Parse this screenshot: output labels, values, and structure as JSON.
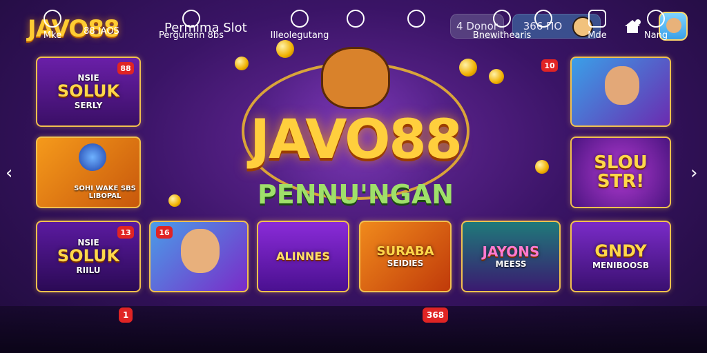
{
  "header": {
    "logo": "JAVO88",
    "title": "Permima Slot",
    "donor_button": "4 Donor",
    "balance": "366 ΠΟ"
  },
  "hero": {
    "title": "JAVO88",
    "subtitle": "PENNU'NGAN"
  },
  "tiles": {
    "t1": {
      "title": "SOLUK",
      "top": "NSIE",
      "sub": "SERLY",
      "badge": "88"
    },
    "t2": {
      "title": "",
      "sub": "SOHI WAKE SBS LIBOPAL"
    },
    "t3": {
      "badge": "10"
    },
    "t4": {
      "title": "SLOU STR!"
    },
    "t5": {
      "title": "SOLUK",
      "top": "NSIE",
      "sub": "RIILU",
      "badge": "13"
    },
    "t6": {
      "badge": "16"
    },
    "t7": {
      "title": "ALINNES"
    },
    "t8": {
      "title": "SURABA",
      "sub": "SEIDIES"
    },
    "t9": {
      "title": "JAYONS",
      "sub": "MEESS"
    },
    "t10": {
      "title": "GNDY",
      "sub": "MENIBOOSB"
    }
  },
  "bottom_nav": [
    {
      "label": "Mke",
      "icon": "compass-icon"
    },
    {
      "label": "88 IAOS",
      "icon": ""
    },
    {
      "label": "Pergurenn 8bs",
      "icon": "gauge-icon"
    },
    {
      "label": "Illeolegutang",
      "icon": "download-icon"
    },
    {
      "label": "",
      "icon": "clock-icon"
    },
    {
      "label": "",
      "icon": "gear-icon"
    },
    {
      "label": "Bnewithearis",
      "icon": "circle-icon"
    },
    {
      "label": "",
      "icon": "wrench-icon"
    },
    {
      "label": "Mde",
      "icon": "grid-icon"
    },
    {
      "label": "Nang",
      "icon": "user-icon"
    }
  ],
  "bottom_badges": {
    "b1": "1",
    "b2": "368"
  }
}
